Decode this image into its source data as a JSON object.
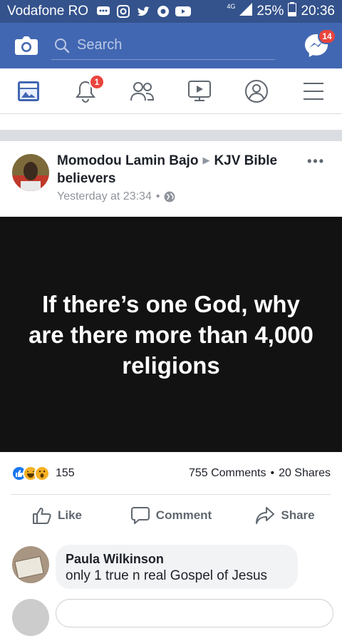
{
  "status_bar": {
    "carrier": "Vodafone RO",
    "network": "4G",
    "battery": "25%",
    "time": "20:36"
  },
  "top_bar": {
    "search_placeholder": "Search",
    "messenger_badge": "14"
  },
  "tabs": [
    {
      "name": "news-feed",
      "icon": "news-feed-icon",
      "active": true
    },
    {
      "name": "notifications",
      "icon": "bell-icon",
      "badge": "1"
    },
    {
      "name": "friends",
      "icon": "friends-icon"
    },
    {
      "name": "watch",
      "icon": "video-icon"
    },
    {
      "name": "profile",
      "icon": "profile-icon"
    },
    {
      "name": "menu",
      "icon": "menu-icon"
    }
  ],
  "post": {
    "author": "Momodou Lamin Bajo",
    "group": "KJV Bible believers",
    "timestamp": "Yesterday at 23:34",
    "image_text": "If there’s one God, why are there more than 4,000 religions",
    "reaction_count": "155",
    "comments": "755 Comments",
    "shares": "20 Shares",
    "separator": "•",
    "actions": {
      "like": "Like",
      "comment": "Comment",
      "share": "Share"
    }
  },
  "comment": {
    "author": "Paula Wilkinson",
    "text": "only 1 true n real Gospel of Jesus"
  },
  "colors": {
    "status_bg": "#34528c",
    "brand_blue": "#4267b2",
    "badge_red": "#e9443d",
    "image_bg": "#121212"
  }
}
